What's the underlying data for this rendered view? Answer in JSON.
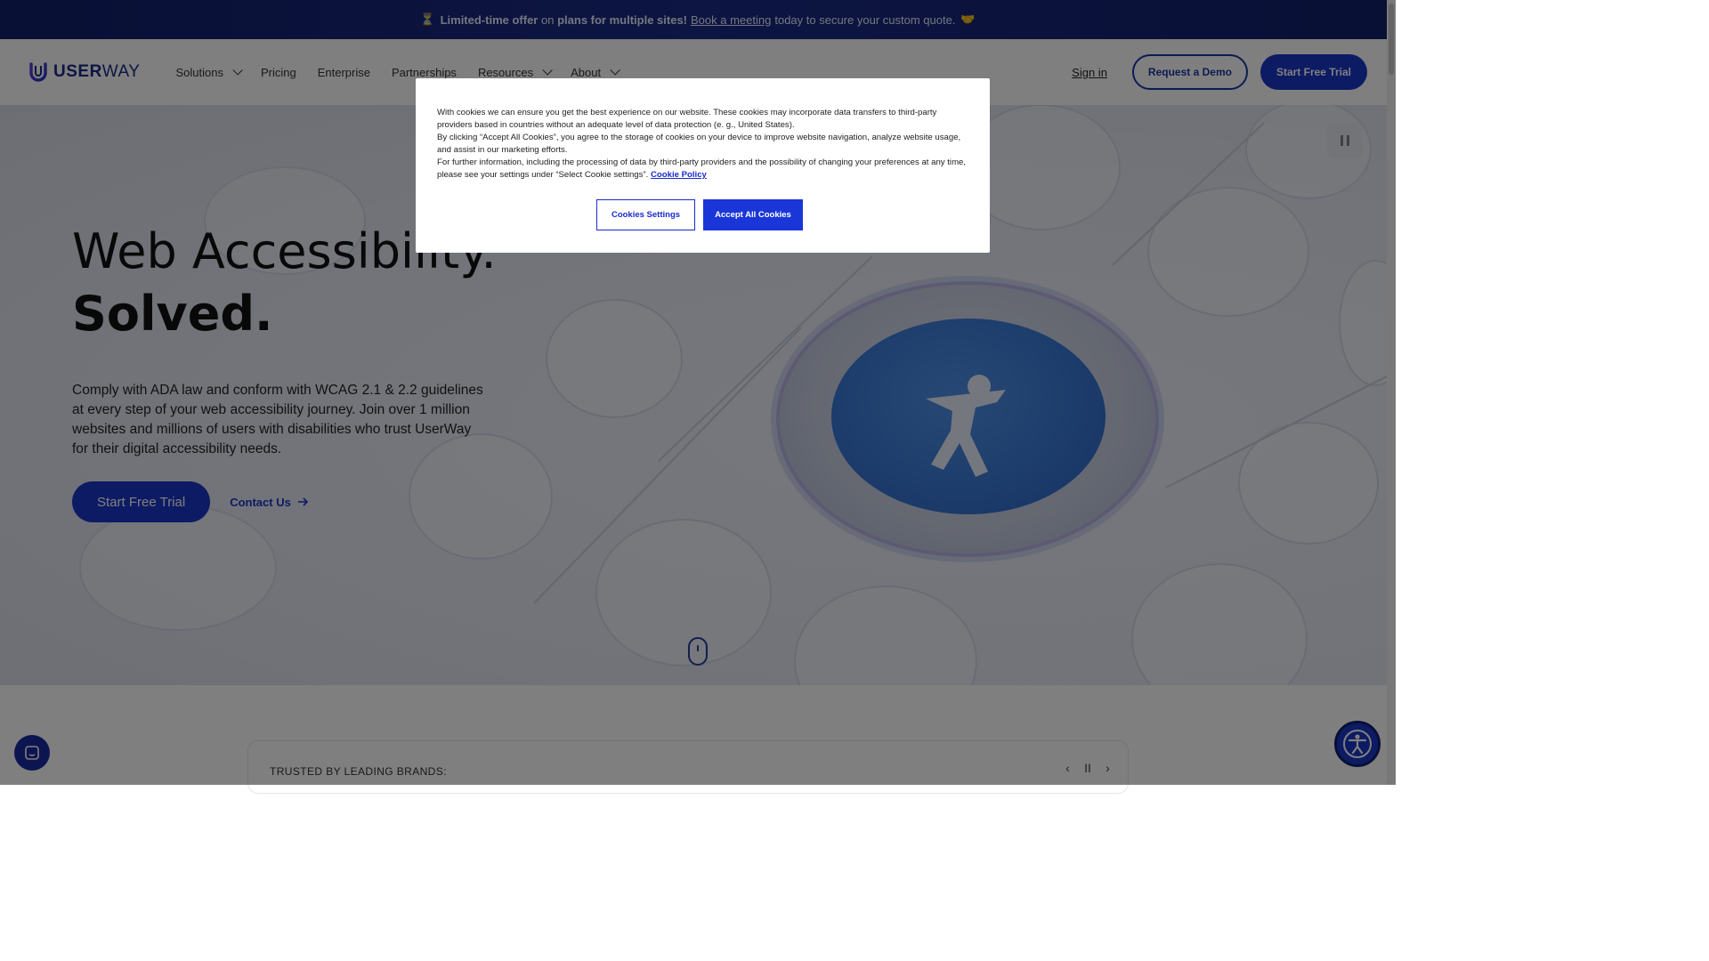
{
  "announcement": {
    "hourglass": "⏳",
    "part1": "Limited-time offer",
    "part2": "on",
    "part3": "plans for multiple sites!",
    "link": "Book a meeting",
    "part4": "today to secure your custom quote.",
    "handshake": "🤝"
  },
  "header": {
    "logo_bold": "USER",
    "logo_light": "WAY",
    "nav": [
      {
        "label": "Solutions",
        "has_menu": true
      },
      {
        "label": "Pricing",
        "has_menu": false
      },
      {
        "label": "Enterprise",
        "has_menu": false
      },
      {
        "label": "Partnerships",
        "has_menu": false
      },
      {
        "label": "Resources",
        "has_menu": true
      },
      {
        "label": "About",
        "has_menu": true
      }
    ],
    "signin": "Sign in",
    "demo": "Request a Demo",
    "trial": "Start Free Trial"
  },
  "hero": {
    "title_line1": "Web Accessibility.",
    "title_line2": "Solved.",
    "description": "Comply with ADA law and conform with WCAG 2.1 & 2.2 guidelines at every step of your web accessibility journey. Join over 1 million websites and millions of users with disabilities who trust UserWay for their digital accessibility needs.",
    "cta_primary": "Start Free Trial",
    "cta_secondary": "Contact Us"
  },
  "trusted": {
    "label": "TRUSTED BY LEADING BRANDS:",
    "prev": "‹",
    "pause": "II",
    "next": "›"
  },
  "cookie": {
    "p1": "With cookies we can ensure you get the best experience on our website. These cookies may incorporate data transfers to third-party providers based in countries without an adequate level of data protection (e. g., United States).",
    "p2": "By clicking “Accept All Cookies”, you agree to the storage of cookies on your device to improve website navigation, analyze website usage, and assist in our marketing efforts.",
    "p3": "For further information, including the processing of data by third-party providers and the possibility of changing your preferences at any time, please see your settings under “Select Cookie settings”.",
    "policy_link": "Cookie Policy",
    "settings_button": "Cookies Settings",
    "accept_button": "Accept All Cookies"
  },
  "colors": {
    "brand_blue": "#1a36c8",
    "announce_bg": "#12206a",
    "overlay": "rgba(0,0,0,0.5)"
  }
}
